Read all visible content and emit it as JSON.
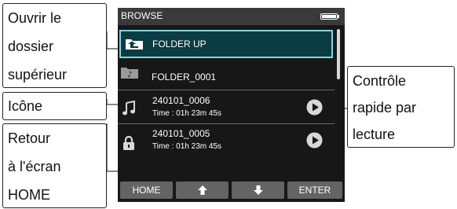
{
  "screen": {
    "title": "BROWSE",
    "items": [
      {
        "label": "FOLDER UP",
        "icon": "folder-up-icon",
        "selected": true
      },
      {
        "label": "FOLDER_0001",
        "icon": "folder-icon"
      },
      {
        "label": "240101_0006",
        "time": "Time : 01h 23m 45s",
        "icon": "music-note-icon"
      },
      {
        "label": "240101_0005",
        "time": "Time : 01h 23m 45s",
        "icon": "lock-icon"
      }
    ],
    "softkeys": {
      "home": "HOME",
      "up": "up-arrow-icon",
      "down": "down-arrow-icon",
      "enter": "ENTER"
    },
    "colors": {
      "screen_bg": "#171717",
      "title_bar": "#3a3a3a",
      "selection_border": "#7fd7e0",
      "selection_fill": "#0b3b43",
      "softkey_bg": "#646464"
    }
  },
  "callouts": {
    "folder_up": [
      "Ouvrir le",
      "dossier",
      "supérieur"
    ],
    "icon": [
      "Icône"
    ],
    "home": [
      "Retour",
      "à l'écran",
      "HOME"
    ],
    "quick_play": [
      "Contrôle",
      "rapide par",
      "lecture"
    ]
  }
}
